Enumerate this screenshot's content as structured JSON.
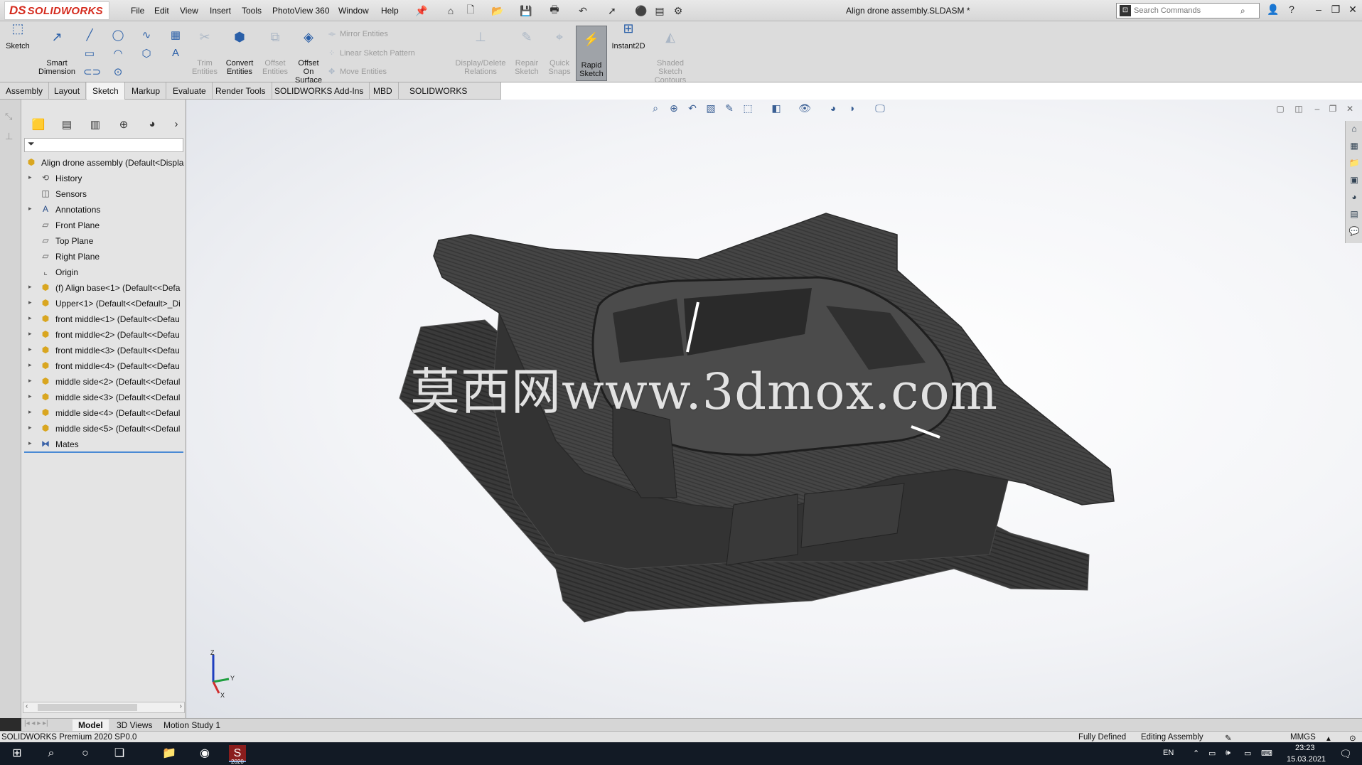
{
  "app": {
    "logo_ds": "DS",
    "logo_text": "SOLIDWORKS",
    "document_title": "Align drone assembly.SLDASM *",
    "menus": [
      "File",
      "Edit",
      "View",
      "Insert",
      "Tools",
      "PhotoView 360",
      "Window",
      "Help"
    ],
    "search_placeholder": "Search Commands"
  },
  "command_manager": {
    "sketch": "Sketch",
    "smart_dimension": "Smart\nDimension",
    "trim_entities": "Trim\nEntities",
    "convert_entities": "Convert\nEntities",
    "offset_entities": "Offset\nEntities",
    "offset_on_surface": "Offset\nOn\nSurface",
    "mirror_entities": "Mirror Entities",
    "linear_sketch_pattern": "Linear Sketch Pattern",
    "move_entities": "Move Entities",
    "display_delete_relations": "Display/Delete\nRelations",
    "repair_sketch": "Repair\nSketch",
    "quick_snaps": "Quick\nSnaps",
    "rapid_sketch": "Rapid\nSketch",
    "instant2d": "Instant2D",
    "shaded_sketch_contours": "Shaded\nSketch\nContours"
  },
  "tabs": [
    "Assembly",
    "Layout",
    "Sketch",
    "Markup",
    "Evaluate",
    "Render Tools",
    "SOLIDWORKS Add-Ins",
    "MBD",
    "SOLIDWORKS Visualize"
  ],
  "feature_tree": {
    "root": "Align drone assembly  (Default<Displa",
    "items": [
      {
        "label": "History",
        "icon": "history-icon"
      },
      {
        "label": "Sensors",
        "icon": "sensors-icon"
      },
      {
        "label": "Annotations",
        "icon": "annotations-icon"
      },
      {
        "label": "Front Plane",
        "icon": "plane-icon"
      },
      {
        "label": "Top Plane",
        "icon": "plane-icon"
      },
      {
        "label": "Right Plane",
        "icon": "plane-icon"
      },
      {
        "label": "Origin",
        "icon": "origin-icon"
      },
      {
        "label": "(f) Align base<1> (Default<<Defa",
        "icon": "part-icon"
      },
      {
        "label": "Upper<1> (Default<<Default>_Di",
        "icon": "part-icon"
      },
      {
        "label": "front middle<1> (Default<<Defau",
        "icon": "part-icon"
      },
      {
        "label": "front middle<2> (Default<<Defau",
        "icon": "part-icon"
      },
      {
        "label": "front middle<3> (Default<<Defau",
        "icon": "part-icon"
      },
      {
        "label": "front middle<4> (Default<<Defau",
        "icon": "part-icon"
      },
      {
        "label": "middle side<2> (Default<<Defaul",
        "icon": "part-icon"
      },
      {
        "label": "middle side<3> (Default<<Defaul",
        "icon": "part-icon"
      },
      {
        "label": "middle side<4> (Default<<Defaul",
        "icon": "part-icon"
      },
      {
        "label": "middle side<5> (Default<<Defaul",
        "icon": "part-icon"
      },
      {
        "label": "Mates",
        "icon": "mates-icon"
      }
    ]
  },
  "viewport": {
    "watermark": "莫西网www.3dmox.com",
    "triad_labels": {
      "z": "Z",
      "y": "Y",
      "x": "X"
    }
  },
  "bottom_tabs": [
    "Model",
    "3D Views",
    "Motion Study 1"
  ],
  "status_bar": {
    "product": "SOLIDWORKS Premium 2020 SP0.0",
    "sketch_state": "Fully Defined",
    "mode": "Editing Assembly",
    "units": "MMGS"
  },
  "taskbar": {
    "language": "EN",
    "time": "23:23",
    "date": "15.03.2021",
    "sw_badge": "2020"
  },
  "colors": {
    "brand": "#d52b1e",
    "accent": "#4a8ad4",
    "carbon": "#3a3a3a"
  }
}
